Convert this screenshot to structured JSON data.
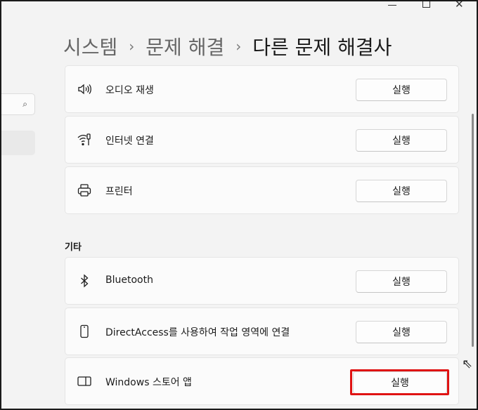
{
  "window": {
    "minimize": "",
    "maximize": "",
    "close": "✕"
  },
  "breadcrumb": {
    "part1": "시스템",
    "part2": "문제 해결",
    "current": "다른 문제 해결사",
    "separator": "›"
  },
  "nav": {
    "search_icon": "⌕"
  },
  "section_other": "기타",
  "items": [
    {
      "label": "오디오 재생",
      "icon": "speaker-icon",
      "button": "실행"
    },
    {
      "label": "인터넷 연결",
      "icon": "wifi-icon",
      "button": "실행"
    },
    {
      "label": "프린터",
      "icon": "printer-icon",
      "button": "실행"
    },
    {
      "label": "Bluetooth",
      "icon": "bluetooth-icon",
      "button": "실행"
    },
    {
      "label": "DirectAccess를 사용하여 작업 영역에 연결",
      "icon": "phone-icon",
      "button": "실행"
    },
    {
      "label": "Windows 스토어 앱",
      "icon": "tablet-icon",
      "button": "실행"
    }
  ],
  "colors": {
    "highlight": "#e01313",
    "background": "#f3f3f3",
    "card": "#fbfbfb"
  }
}
